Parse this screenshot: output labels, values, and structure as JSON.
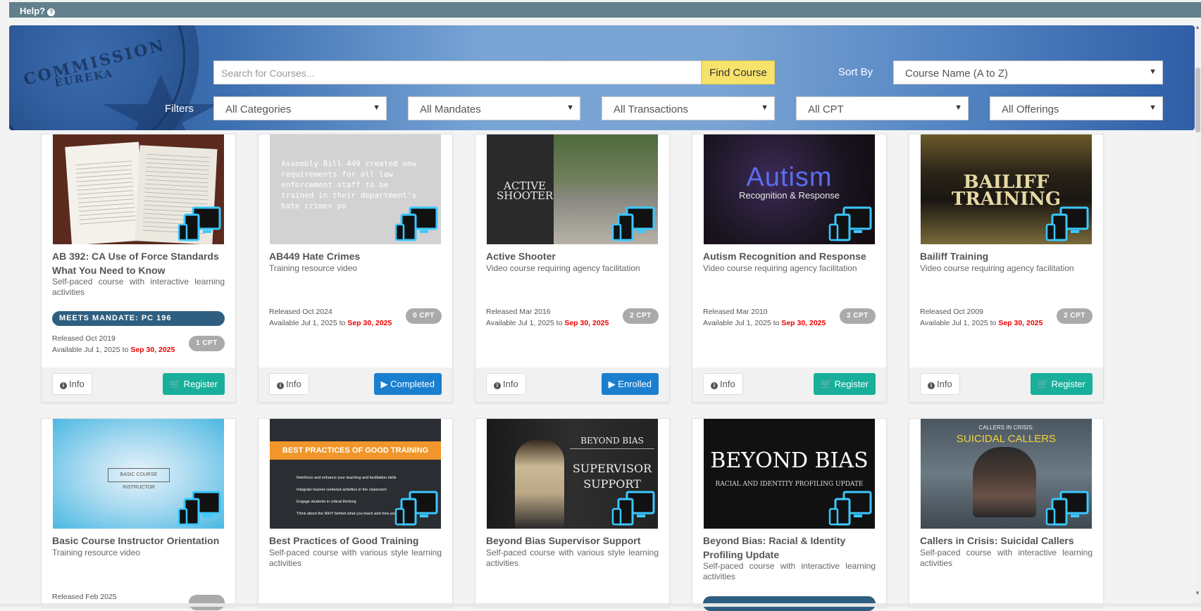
{
  "topbar": {
    "help_label": "Help?"
  },
  "search": {
    "placeholder": "Search for Courses...",
    "find_label": "Find Course"
  },
  "sort": {
    "label": "Sort By",
    "selected": "Course Name (A to Z)"
  },
  "filters": {
    "label": "Filters",
    "categories": "All Categories",
    "mandates": "All Mandates",
    "transactions": "All Transactions",
    "cpt": "All CPT",
    "offerings": "All Offerings"
  },
  "seal": {
    "line1": "COMMISSION",
    "line2": "EUREKA"
  },
  "info_label": "Info",
  "courses": [
    {
      "title": "AB 392: CA Use of Force Standards What You Need to Know",
      "desc": "Self-paced course with interactive learning activities",
      "mandate": "MEETS MANDATE: PC 196",
      "released": "Released Oct 2019",
      "avail_prefix": "Available Jul 1, 2025 to",
      "avail_end": "Sep 30, 2025",
      "cpt": "1 CPT",
      "action": "Register",
      "thumb_text": ""
    },
    {
      "title": "AB449 Hate Crimes",
      "desc": "Training resource video",
      "released": "Released Oct 2024",
      "avail_prefix": "Available Jul 1, 2025 to",
      "avail_end": "Sep 30, 2025",
      "cpt": "0 CPT",
      "action": "Completed",
      "thumb_text": "Assembly Bill 449 created new requirements for all law enforcement staff to be trained in their department's hate crimes po"
    },
    {
      "title": "Active Shooter",
      "desc": "Video course requiring agency facilitation",
      "released": "Released Mar 2016",
      "avail_prefix": "Available Jul 1, 2025 to",
      "avail_end": "Sep 30, 2025",
      "cpt": "2 CPT",
      "action": "Enrolled",
      "thumb_text": "ACTIVE SHOOTER"
    },
    {
      "title": "Autism Recognition and Response",
      "desc": "Video course requiring agency facilitation",
      "released": "Released Mar 2010",
      "avail_prefix": "Available Jul 1, 2025 to",
      "avail_end": "Sep 30, 2025",
      "cpt": "2 CPT",
      "action": "Register",
      "thumb_text": "Autism",
      "thumb_sub": "Recognition & Response"
    },
    {
      "title": "Bailiff Training",
      "desc": "Video course requiring agency facilitation",
      "released": "Released Oct 2009",
      "avail_prefix": "Available Jul 1, 2025 to",
      "avail_end": "Sep 30, 2025",
      "cpt": "2 CPT",
      "action": "Register",
      "thumb_text": "BAILIFF",
      "thumb_sub": "TRAINING"
    },
    {
      "title": "Basic Course Instructor Orientation",
      "desc": "Training resource video",
      "released": "Released Feb 2025",
      "thumb_text": "BASIC COURSE INSTRUCTOR"
    },
    {
      "title": "Best Practices of Good Training",
      "desc": "Self-paced course with various style learning activities",
      "thumb_text": "BEST PRACTICES OF GOOD TRAINING",
      "bullets": [
        "Reinforce and enhance your teaching and facilitation skills",
        "Integrate learner-centered activities in the classroom",
        "Engage students in critical thinking",
        "Think about the WHY behind what you teach and how you t"
      ]
    },
    {
      "title": "Beyond Bias Supervisor Support",
      "desc": "Self-paced course with various style learning activities",
      "thumb_text": "BEYOND BIAS",
      "thumb_sub": "SUPERVISOR",
      "thumb_sub2": "SUPPORT"
    },
    {
      "title": "Beyond Bias: Racial & Identity Profiling Update",
      "desc": "Self-paced course with interactive learning activities",
      "thumb_text": "BEYOND BIAS",
      "thumb_sub": "RACIAL AND IDENTITY PROFILING UPDATE"
    },
    {
      "title": "Callers in Crisis: Suicidal Callers",
      "desc": "Self-paced course with interactive learning activities",
      "thumb_text": "SUICIDAL CALLERS",
      "thumb_sub": "CALLERS IN CRISIS:"
    }
  ],
  "colors": {
    "register": "#18b09a",
    "completed": "#1b7fcf",
    "mandate": "#2f5f80",
    "findCourse": "#f7e36b",
    "topbar": "#61808c"
  }
}
